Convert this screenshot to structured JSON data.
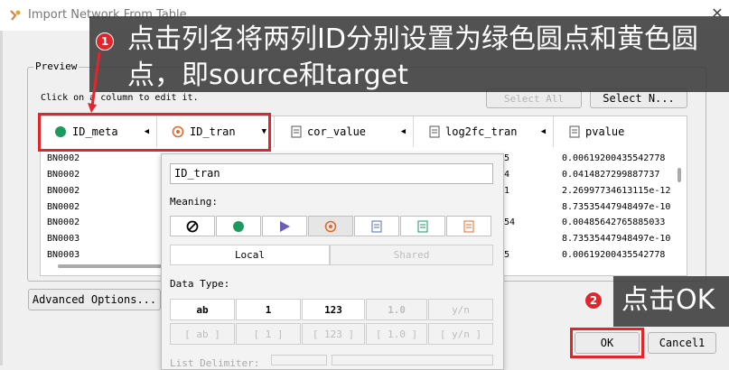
{
  "window": {
    "title": "Import Network From Table",
    "close_glyph": "✕"
  },
  "preview": {
    "label": "Preview",
    "hint": "Click on a column to edit it.",
    "select_all": "Select All",
    "select_none": "Select N..."
  },
  "columns": [
    {
      "label": "ID_meta",
      "icon": "green-circle-icon",
      "arrow": "◀"
    },
    {
      "label": "ID_tran",
      "icon": "orange-target-icon",
      "arrow": "▼"
    },
    {
      "label": "cor_value",
      "icon": "document-icon",
      "arrow": "◀"
    },
    {
      "label": "log2fc_tran",
      "icon": "document-icon",
      "arrow": "◀"
    },
    {
      "label": "pvalue",
      "icon": "document-icon",
      "arrow": ""
    }
  ],
  "rows": {
    "id_meta": [
      "BN0002",
      "BN0002",
      "BN0002",
      "BN0002",
      "BN0002",
      "BN0003",
      "BN0003"
    ],
    "cor_partial": [
      "5",
      "4",
      "1",
      "",
      "54",
      "",
      "5"
    ],
    "pvalue": [
      "0.0061920043554277​8",
      "0.0414827299887737",
      "2.26997734613115e-12",
      "8.73535447948497e-10",
      "0.00485642765885033",
      "8.73535447948497e-10",
      "0.0061920043554277​8"
    ]
  },
  "editor": {
    "name_value": "ID_tran",
    "meaning_label": "Meaning:",
    "local": "Local",
    "shared": "Shared",
    "data_type_label": "Data Type:",
    "types_row1": [
      "ab",
      "1",
      "123",
      "1.0",
      "y/n"
    ],
    "types_row2": [
      "[ ab ]",
      "[ 1 ]",
      "[ 123 ]",
      "[ 1.0 ]",
      "[ y/n ]"
    ],
    "list_delimiter_label": "List Delimiter:"
  },
  "advanced_options": "Advanced Options...",
  "ok": "OK",
  "cancel": "Cancel1",
  "annotations": {
    "step1_badge": "1",
    "step1_text": "点击列名将两列ID分别设置为绿色圆点和黄色圆点，即source和target",
    "step2_badge": "2",
    "step2_text": "点击OK"
  },
  "colors": {
    "accent_red": "#e0262b",
    "green_dot": "#1a9a5c",
    "orange_target": "#e06a2c",
    "play_purple": "#6b5fb5"
  }
}
